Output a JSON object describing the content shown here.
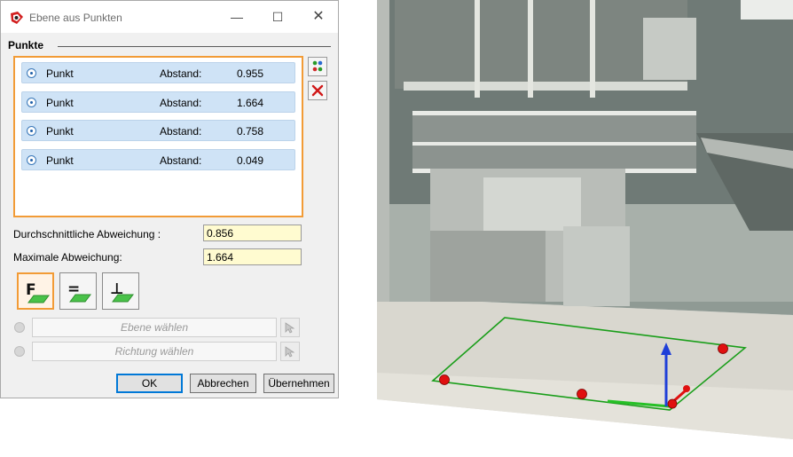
{
  "window": {
    "title": "Ebene aus Punkten",
    "minimize_glyph": "—",
    "maximize_glyph": "☐",
    "close_glyph": "✕"
  },
  "points_group": {
    "title": "Punkte",
    "rows": [
      {
        "label": "Punkt",
        "distance_label": "Abstand:",
        "distance": "0.955"
      },
      {
        "label": "Punkt",
        "distance_label": "Abstand:",
        "distance": "1.664"
      },
      {
        "label": "Punkt",
        "distance_label": "Abstand:",
        "distance": "0.758"
      },
      {
        "label": "Punkt",
        "distance_label": "Abstand:",
        "distance": "0.049"
      }
    ]
  },
  "stats": {
    "average_label": "Durchschnittliche Abweichung :",
    "average_value": "0.856",
    "max_label": "Maximale Abweichung:",
    "max_value": "1.664"
  },
  "mode_buttons": [
    {
      "glyph": "F",
      "icon": "free-plane-icon",
      "active": true
    },
    {
      "glyph": "=",
      "icon": "parallel-plane-icon",
      "active": false
    },
    {
      "glyph": "⊥",
      "icon": "perpendicular-plane-icon",
      "active": false
    }
  ],
  "selectors": {
    "plane_label": "Ebene wählen",
    "direction_label": "Richtung wählen"
  },
  "buttons": {
    "ok": "OK",
    "cancel": "Abbrechen",
    "apply": "Übernehmen"
  },
  "colors": {
    "accent_orange": "#f29b36",
    "row_highlight": "#cfe3f6",
    "value_field": "#fffbd0",
    "plane_outline": "#1a9e1a",
    "axis_blue": "#1f3fd8",
    "point_red": "#e01010"
  }
}
